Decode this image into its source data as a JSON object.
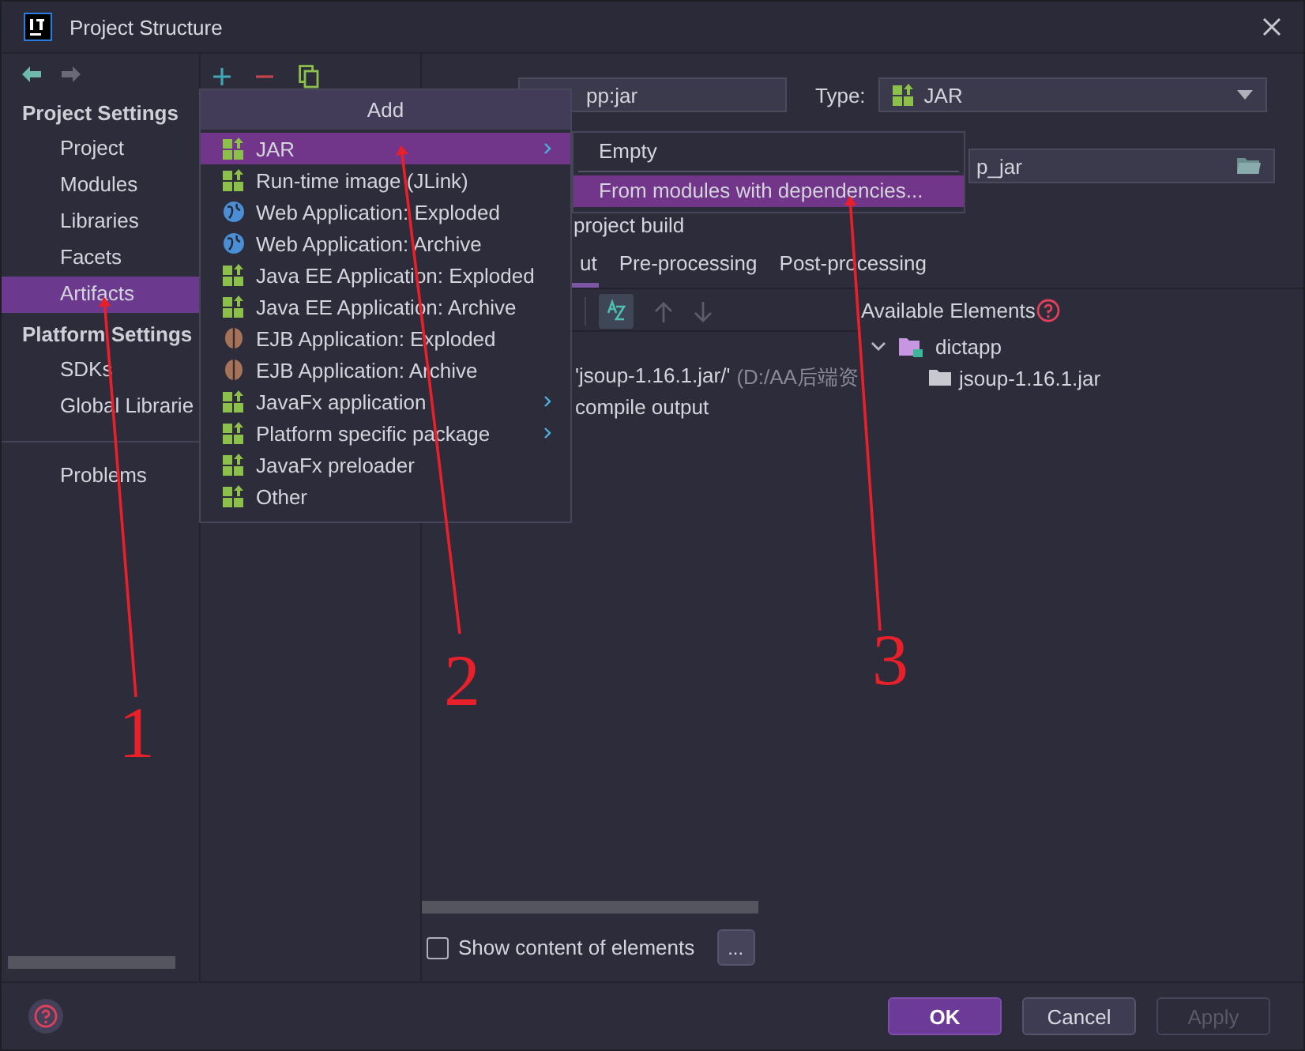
{
  "window": {
    "title": "Project Structure"
  },
  "sidebar": {
    "sections": [
      {
        "heading": "Project Settings",
        "items": [
          {
            "label": "Project",
            "selected": false
          },
          {
            "label": "Modules",
            "selected": false
          },
          {
            "label": "Libraries",
            "selected": false
          },
          {
            "label": "Facets",
            "selected": false
          },
          {
            "label": "Artifacts",
            "selected": true
          }
        ]
      },
      {
        "heading": "Platform Settings",
        "items": [
          {
            "label": "SDKs",
            "selected": false
          },
          {
            "label": "Global Librarie",
            "selected": false
          }
        ]
      }
    ],
    "bottom_items": [
      {
        "label": "Problems",
        "selected": false
      }
    ]
  },
  "add_menu": {
    "title": "Add",
    "items": [
      {
        "label": "JAR",
        "kind": "jar",
        "submenu": true,
        "selected": true
      },
      {
        "label": "Run-time image (JLink)",
        "kind": "jar",
        "submenu": false,
        "selected": false
      },
      {
        "label": "Web Application: Exploded",
        "kind": "globe",
        "submenu": false,
        "selected": false
      },
      {
        "label": "Web Application: Archive",
        "kind": "globe",
        "submenu": false,
        "selected": false
      },
      {
        "label": "Java EE Application: Exploded",
        "kind": "jar",
        "submenu": false,
        "selected": false
      },
      {
        "label": "Java EE Application: Archive",
        "kind": "jar",
        "submenu": false,
        "selected": false
      },
      {
        "label": "EJB Application: Exploded",
        "kind": "bean",
        "submenu": false,
        "selected": false
      },
      {
        "label": "EJB Application: Archive",
        "kind": "bean",
        "submenu": false,
        "selected": false
      },
      {
        "label": "JavaFx application",
        "kind": "jar",
        "submenu": true,
        "selected": false
      },
      {
        "label": "Platform specific package",
        "kind": "jar",
        "submenu": true,
        "selected": false
      },
      {
        "label": "JavaFx preloader",
        "kind": "jar",
        "submenu": false,
        "selected": false
      },
      {
        "label": "Other",
        "kind": "jar",
        "submenu": false,
        "selected": false
      }
    ]
  },
  "submenu": {
    "items": [
      {
        "label": "Empty",
        "selected": false
      },
      {
        "label": "From modules with dependencies...",
        "selected": true
      }
    ]
  },
  "artifact": {
    "name": "pp:jar",
    "type_label": "Type:",
    "type": "JAR",
    "output_directory": "p_jar",
    "include_build": "project build",
    "tabs": [
      {
        "label": "ut",
        "selected": true
      },
      {
        "label": "Pre-processing",
        "selected": false
      },
      {
        "label": "Post-processing",
        "selected": false
      }
    ],
    "available_label": "Available Elements",
    "output_tree": [
      {
        "label": "'jsoup-1.16.1.jar/'",
        "detail": "(D:/AA后端资"
      },
      {
        "label": "compile output"
      }
    ],
    "available_tree": [
      {
        "label": "dictapp",
        "kind": "module",
        "expanded": true,
        "children": [
          {
            "label": "jsoup-1.16.1.jar",
            "kind": "folder"
          }
        ]
      }
    ],
    "show_content": {
      "label": "Show content of elements",
      "checked": false
    },
    "more_button": "..."
  },
  "buttons": [
    {
      "label": "OK",
      "kind": "primary"
    },
    {
      "label": "Cancel",
      "kind": "normal"
    },
    {
      "label": "Apply",
      "kind": "disabled"
    }
  ],
  "annotations": [
    {
      "label": "1"
    },
    {
      "label": "2"
    },
    {
      "label": "3"
    }
  ]
}
